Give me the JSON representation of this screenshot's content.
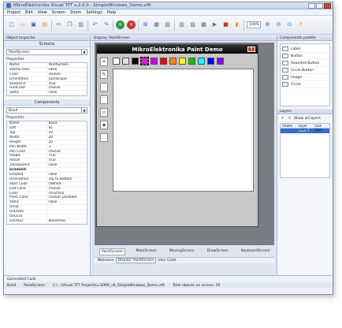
{
  "window": {
    "title": "MikroElektronika Visual TFT v.2.0.0 - SimpleWindows_Demo.vtft"
  },
  "menu": [
    "Project",
    "Edit",
    "View",
    "Screen",
    "Zoom",
    "Settings",
    "Help"
  ],
  "toolbar": {
    "zoom": "100%"
  },
  "left_panel": {
    "title": "Object Inspector",
    "screens_header": "Screens",
    "screen_selected": "PaintScreen",
    "properties_label": "Properties",
    "screen_props": [
      {
        "k": "Name",
        "v": "PaintScreen"
      },
      {
        "k": "StartScreen",
        "v": "False"
      },
      {
        "k": "Color",
        "v": "clSilver"
      },
      {
        "k": "Orientation",
        "v": "Landscape"
      },
      {
        "k": "ShowGrid",
        "v": "True"
      },
      {
        "k": "GridColor",
        "v": "clSilver"
      },
      {
        "k": "Static",
        "v": "False"
      }
    ],
    "components_header": "Components",
    "component_selected": "Box4",
    "component_props": [
      {
        "k": "Name",
        "v": "Box4"
      },
      {
        "k": "Left",
        "v": "81"
      },
      {
        "k": "Top",
        "v": "29"
      },
      {
        "k": "Width",
        "v": "20"
      },
      {
        "k": "Height",
        "v": "20"
      },
      {
        "k": "Pen Width",
        "v": "3"
      },
      {
        "k": "Pen Color",
        "v": "clSilver"
      },
      {
        "k": "Visible",
        "v": "True"
      },
      {
        "k": "Active",
        "v": "True"
      },
      {
        "k": "Transparent",
        "v": "False"
      },
      {
        "k": "Gradient",
        "v": ""
      },
      {
        "k": "Enabled",
        "v": "False"
      },
      {
        "k": "Orientation",
        "v": "Top to Bottom"
      },
      {
        "k": "Start Color",
        "v": "clWhite"
      },
      {
        "k": "End Color",
        "v": "clSilver"
      },
      {
        "k": "Color",
        "v": "clFuchsia"
      },
      {
        "k": "Press Color",
        "v": "clSilver  Disabled"
      },
      {
        "k": "Static",
        "v": "False"
      },
      {
        "k": "OnUp",
        "v": ""
      },
      {
        "k": "OnDown",
        "v": ""
      },
      {
        "k": "OnClick",
        "v": ""
      },
      {
        "k": "OnPress",
        "v": "BoxxPress"
      }
    ]
  },
  "center": {
    "title": "Display: PaintScreen",
    "device_title": "MikroElektronika Paint Demo",
    "device_close": "X",
    "palette_colors": [
      "#ffffff",
      "#e0e0e0",
      "#000000",
      "#ff00ff",
      "#cc00ff",
      "#ff0000",
      "#ff8800",
      "#ffff00",
      "#00cc00",
      "#00ffff",
      "#0000ff",
      "#8800ff"
    ],
    "tabs": [
      {
        "label": "PaintScreen",
        "active": true
      },
      {
        "label": "MainScreen",
        "active": false
      },
      {
        "label": "MovingScreen",
        "active": false
      },
      {
        "label": "DrawScreen",
        "active": false
      },
      {
        "label": "KeyboardScreen",
        "active": false
      }
    ],
    "subtabs": [
      "Welcome",
      "Display: PaintScreen",
      "User Code"
    ]
  },
  "right_panel": {
    "palette_title": "Components palette",
    "items": [
      "Label",
      "Button",
      "Rounded Button",
      "Circle Button",
      "Image",
      "Circle"
    ],
    "layers_title": "Layers",
    "layers_show_all": "Show all layers",
    "layers_cols": [
      "Visible",
      "Layer name",
      "Lock layer"
    ],
    "layer_row": [
      "",
      "Layer1",
      ""
    ]
  },
  "status": {
    "generated": "Generated Code",
    "path": "C:\\...\\Visual TFT Projects\\v.32MX_v9_SimpleWindows_Demo.vtft",
    "objects": "Total objects on screen: 29",
    "tabs": [
      "Build",
      "PaintScreen"
    ]
  }
}
